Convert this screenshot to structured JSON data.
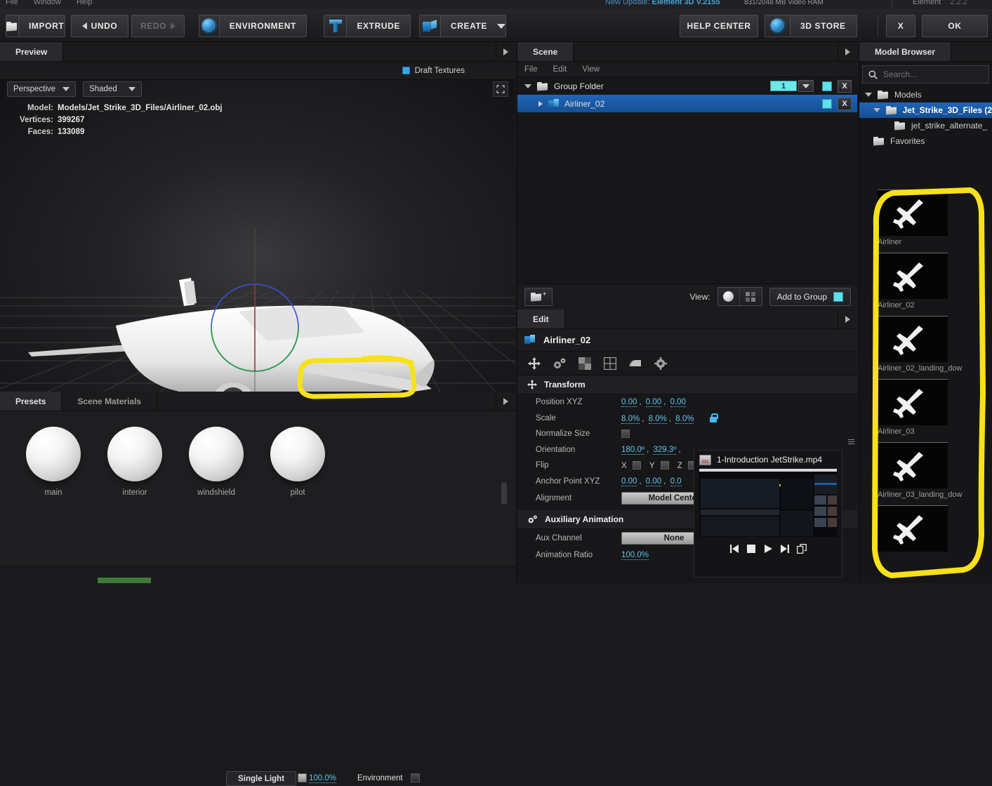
{
  "topbar": {
    "menu": [
      "File",
      "Window",
      "Help"
    ],
    "update_prefix": "New Update:",
    "update_version": "Element 3D V.2155",
    "video_ram": "831/2048 MB Video RAM",
    "app_name": "Element",
    "app_version": "2.2.2"
  },
  "toolbar": {
    "import": "IMPORT",
    "undo": "UNDO",
    "redo": "REDO",
    "environment": "ENVIRONMENT",
    "extrude": "EXTRUDE",
    "create": "CREATE",
    "help_center": "HELP CENTER",
    "store_3d": "3D STORE",
    "cancel": "X",
    "ok": "OK"
  },
  "preview": {
    "tab": "Preview",
    "draft_textures": "Draft Textures",
    "view_mode": "Perspective",
    "shading_mode": "Shaded",
    "info": {
      "model_key": "Model:",
      "model_value": "Models/Jet_Strike_3D_Files/Airliner_02.obj",
      "vertices_key": "Vertices:",
      "vertices_value": "399267",
      "faces_key": "Faces:",
      "faces_value": "133089"
    },
    "viewport_toolbar": {
      "light_mode": "Single Light",
      "light_percent": "100.0%",
      "environment_label": "Environment"
    }
  },
  "presets": {
    "tab_presets": "Presets",
    "tab_scene_materials": "Scene Materials",
    "materials": [
      {
        "name": "main"
      },
      {
        "name": "interior"
      },
      {
        "name": "windshield"
      },
      {
        "name": "pilot"
      }
    ]
  },
  "scene": {
    "tab": "Scene",
    "menu": [
      "File",
      "Edit",
      "View"
    ],
    "tree": [
      {
        "label": "Group Folder",
        "count": "1",
        "close": "X",
        "selected": false
      },
      {
        "label": "Airliner_02",
        "close": "X",
        "selected": true
      }
    ],
    "footer": {
      "view_label": "View:",
      "add_to_group": "Add to Group"
    }
  },
  "edit": {
    "tab": "Edit",
    "object_name": "Airliner_02",
    "sections": {
      "transform": "Transform",
      "auxiliary_animation": "Auxiliary Animation"
    },
    "properties": {
      "position_label": "Position XYZ",
      "position_x": "0.00",
      "position_y": "0.00",
      "position_z": "0.00",
      "scale_label": "Scale",
      "scale_x": "8.0%",
      "scale_y": "8.0%",
      "scale_z": "8.0%",
      "normalize_label": "Normalize Size",
      "orientation_label": "Orientation",
      "orientation_x": "180.0º",
      "orientation_y": "329.3º",
      "flip_label": "Flip",
      "flip_x": "X",
      "flip_y": "Y",
      "flip_z": "Z",
      "anchor_label": "Anchor Point XYZ",
      "anchor_x": "0.00",
      "anchor_y": "0.00",
      "anchor_z": "0.0",
      "alignment_label": "Alignment",
      "alignment_value": "Model Center",
      "aux_channel_label": "Aux Channel",
      "aux_channel_value": "None",
      "animation_ratio_label": "Animation Ratio",
      "animation_ratio_value": "100.0%"
    }
  },
  "model_browser": {
    "tab": "Model Browser",
    "search_placeholder": "Search...",
    "tree": [
      {
        "label": "Models",
        "depth": 0,
        "expanded": true,
        "selected": false
      },
      {
        "label": "Jet_Strike_3D_Files (2",
        "depth": 1,
        "expanded": true,
        "selected": true
      },
      {
        "label": "jet_strike_alternate_",
        "depth": 2,
        "expanded": false,
        "selected": false
      },
      {
        "label": "Favorites",
        "depth": 0,
        "expanded": false,
        "selected": false
      }
    ],
    "items": [
      {
        "name": "Airliner"
      },
      {
        "name": "Airliner_02"
      },
      {
        "name": "Airliner_02_landing_dow"
      },
      {
        "name": "Airliner_03"
      },
      {
        "name": "Airliner_03_landing_dow"
      },
      {
        "name": ""
      }
    ]
  },
  "video_overlay": {
    "title": "1-Introduction JetStrike.mp4",
    "controls": [
      "previous",
      "stop",
      "play",
      "next",
      "popout"
    ]
  },
  "colors": {
    "accent_blue": "#5fc5e8",
    "highlight_yellow": "#f7e11a",
    "selection_blue": "#1f65b8",
    "cyan_field": "#6fe6e8"
  }
}
